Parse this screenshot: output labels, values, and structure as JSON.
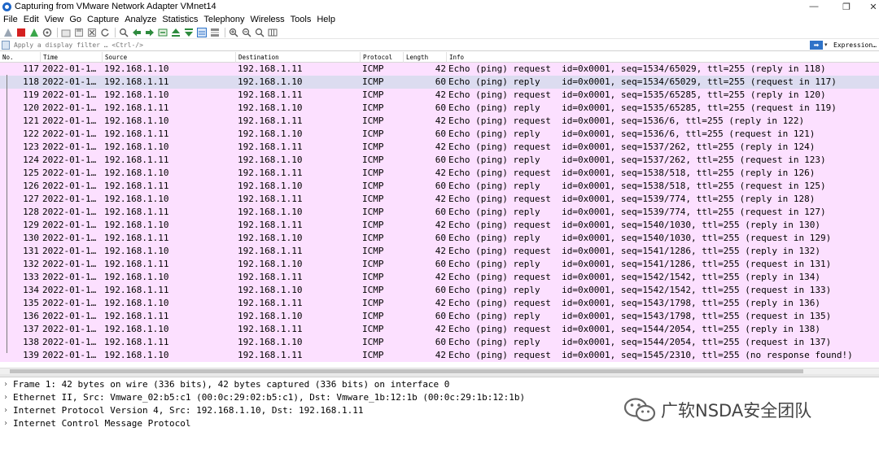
{
  "window": {
    "title": "Capturing from VMware Network Adapter VMnet14",
    "controls": {
      "minimize": "—",
      "restore": "❐",
      "close": "✕"
    }
  },
  "menu": [
    "File",
    "Edit",
    "View",
    "Go",
    "Capture",
    "Analyze",
    "Statistics",
    "Telephony",
    "Wireless",
    "Tools",
    "Help"
  ],
  "toolbar": {
    "icons": [
      "shark-fin-icon",
      "stop-icon",
      "restart-icon",
      "options-icon",
      "open-icon",
      "save-icon",
      "close-file-icon",
      "reload-icon",
      "find-icon",
      "back-icon",
      "forward-icon",
      "goto-icon",
      "first-icon",
      "last-icon",
      "autoscroll-icon",
      "colorize-icon",
      "zoom-in-icon",
      "zoom-out-icon",
      "zoom-reset-icon",
      "resize-columns-icon"
    ]
  },
  "filter": {
    "placeholder": "Apply a display filter … <Ctrl-/>",
    "expression_label": "Expression…"
  },
  "packet_list": {
    "columns": [
      "No.",
      "Time",
      "Source",
      "Destination",
      "Protocol",
      "Length",
      "Info"
    ],
    "selected_index": 1,
    "rows": [
      {
        "no": "117",
        "time": "2022-01-1…",
        "src": "192.168.1.10",
        "dst": "192.168.1.11",
        "proto": "ICMP",
        "len": "42",
        "info": "Echo (ping) request  id=0x0001, seq=1534/65029, ttl=255 (reply in 118)"
      },
      {
        "no": "118",
        "time": "2022-01-1…",
        "src": "192.168.1.11",
        "dst": "192.168.1.10",
        "proto": "ICMP",
        "len": "60",
        "info": "Echo (ping) reply    id=0x0001, seq=1534/65029, ttl=255 (request in 117)"
      },
      {
        "no": "119",
        "time": "2022-01-1…",
        "src": "192.168.1.10",
        "dst": "192.168.1.11",
        "proto": "ICMP",
        "len": "42",
        "info": "Echo (ping) request  id=0x0001, seq=1535/65285, ttl=255 (reply in 120)"
      },
      {
        "no": "120",
        "time": "2022-01-1…",
        "src": "192.168.1.11",
        "dst": "192.168.1.10",
        "proto": "ICMP",
        "len": "60",
        "info": "Echo (ping) reply    id=0x0001, seq=1535/65285, ttl=255 (request in 119)"
      },
      {
        "no": "121",
        "time": "2022-01-1…",
        "src": "192.168.1.10",
        "dst": "192.168.1.11",
        "proto": "ICMP",
        "len": "42",
        "info": "Echo (ping) request  id=0x0001, seq=1536/6, ttl=255 (reply in 122)"
      },
      {
        "no": "122",
        "time": "2022-01-1…",
        "src": "192.168.1.11",
        "dst": "192.168.1.10",
        "proto": "ICMP",
        "len": "60",
        "info": "Echo (ping) reply    id=0x0001, seq=1536/6, ttl=255 (request in 121)"
      },
      {
        "no": "123",
        "time": "2022-01-1…",
        "src": "192.168.1.10",
        "dst": "192.168.1.11",
        "proto": "ICMP",
        "len": "42",
        "info": "Echo (ping) request  id=0x0001, seq=1537/262, ttl=255 (reply in 124)"
      },
      {
        "no": "124",
        "time": "2022-01-1…",
        "src": "192.168.1.11",
        "dst": "192.168.1.10",
        "proto": "ICMP",
        "len": "60",
        "info": "Echo (ping) reply    id=0x0001, seq=1537/262, ttl=255 (request in 123)"
      },
      {
        "no": "125",
        "time": "2022-01-1…",
        "src": "192.168.1.10",
        "dst": "192.168.1.11",
        "proto": "ICMP",
        "len": "42",
        "info": "Echo (ping) request  id=0x0001, seq=1538/518, ttl=255 (reply in 126)"
      },
      {
        "no": "126",
        "time": "2022-01-1…",
        "src": "192.168.1.11",
        "dst": "192.168.1.10",
        "proto": "ICMP",
        "len": "60",
        "info": "Echo (ping) reply    id=0x0001, seq=1538/518, ttl=255 (request in 125)"
      },
      {
        "no": "127",
        "time": "2022-01-1…",
        "src": "192.168.1.10",
        "dst": "192.168.1.11",
        "proto": "ICMP",
        "len": "42",
        "info": "Echo (ping) request  id=0x0001, seq=1539/774, ttl=255 (reply in 128)"
      },
      {
        "no": "128",
        "time": "2022-01-1…",
        "src": "192.168.1.11",
        "dst": "192.168.1.10",
        "proto": "ICMP",
        "len": "60",
        "info": "Echo (ping) reply    id=0x0001, seq=1539/774, ttl=255 (request in 127)"
      },
      {
        "no": "129",
        "time": "2022-01-1…",
        "src": "192.168.1.10",
        "dst": "192.168.1.11",
        "proto": "ICMP",
        "len": "42",
        "info": "Echo (ping) request  id=0x0001, seq=1540/1030, ttl=255 (reply in 130)"
      },
      {
        "no": "130",
        "time": "2022-01-1…",
        "src": "192.168.1.11",
        "dst": "192.168.1.10",
        "proto": "ICMP",
        "len": "60",
        "info": "Echo (ping) reply    id=0x0001, seq=1540/1030, ttl=255 (request in 129)"
      },
      {
        "no": "131",
        "time": "2022-01-1…",
        "src": "192.168.1.10",
        "dst": "192.168.1.11",
        "proto": "ICMP",
        "len": "42",
        "info": "Echo (ping) request  id=0x0001, seq=1541/1286, ttl=255 (reply in 132)"
      },
      {
        "no": "132",
        "time": "2022-01-1…",
        "src": "192.168.1.11",
        "dst": "192.168.1.10",
        "proto": "ICMP",
        "len": "60",
        "info": "Echo (ping) reply    id=0x0001, seq=1541/1286, ttl=255 (request in 131)"
      },
      {
        "no": "133",
        "time": "2022-01-1…",
        "src": "192.168.1.10",
        "dst": "192.168.1.11",
        "proto": "ICMP",
        "len": "42",
        "info": "Echo (ping) request  id=0x0001, seq=1542/1542, ttl=255 (reply in 134)"
      },
      {
        "no": "134",
        "time": "2022-01-1…",
        "src": "192.168.1.11",
        "dst": "192.168.1.10",
        "proto": "ICMP",
        "len": "60",
        "info": "Echo (ping) reply    id=0x0001, seq=1542/1542, ttl=255 (request in 133)"
      },
      {
        "no": "135",
        "time": "2022-01-1…",
        "src": "192.168.1.10",
        "dst": "192.168.1.11",
        "proto": "ICMP",
        "len": "42",
        "info": "Echo (ping) request  id=0x0001, seq=1543/1798, ttl=255 (reply in 136)"
      },
      {
        "no": "136",
        "time": "2022-01-1…",
        "src": "192.168.1.11",
        "dst": "192.168.1.10",
        "proto": "ICMP",
        "len": "60",
        "info": "Echo (ping) reply    id=0x0001, seq=1543/1798, ttl=255 (request in 135)"
      },
      {
        "no": "137",
        "time": "2022-01-1…",
        "src": "192.168.1.10",
        "dst": "192.168.1.11",
        "proto": "ICMP",
        "len": "42",
        "info": "Echo (ping) request  id=0x0001, seq=1544/2054, ttl=255 (reply in 138)"
      },
      {
        "no": "138",
        "time": "2022-01-1…",
        "src": "192.168.1.11",
        "dst": "192.168.1.10",
        "proto": "ICMP",
        "len": "60",
        "info": "Echo (ping) reply    id=0x0001, seq=1544/2054, ttl=255 (request in 137)"
      },
      {
        "no": "139",
        "time": "2022-01-1…",
        "src": "192.168.1.10",
        "dst": "192.168.1.11",
        "proto": "ICMP",
        "len": "42",
        "info": "Echo (ping) request  id=0x0001, seq=1545/2310, ttl=255 (no response found!)"
      }
    ]
  },
  "packet_details": [
    "Frame 1: 42 bytes on wire (336 bits), 42 bytes captured (336 bits) on interface 0",
    "Ethernet II, Src: Vmware_02:b5:c1 (00:0c:29:02:b5:c1), Dst: Vmware_1b:12:1b (00:0c:29:1b:12:1b)",
    "Internet Protocol Version 4, Src: 192.168.1.10, Dst: 192.168.1.11",
    "Internet Control Message Protocol"
  ],
  "watermark": {
    "text": "广软NSDA安全团队"
  },
  "colors": {
    "row_icmp": "#fce0ff",
    "row_selected": "#dcdcf0",
    "accent": "#2f73c8"
  }
}
